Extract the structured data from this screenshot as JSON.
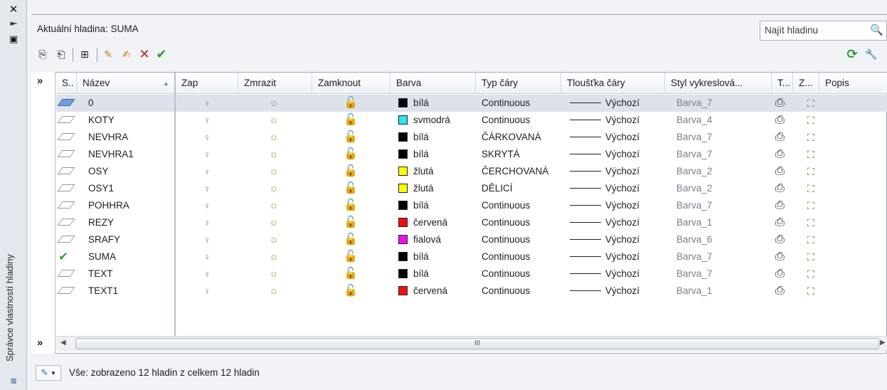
{
  "sidebar_title": "Správce vlastností hladiny",
  "current_layer": "Aktuální hladina: SUMA",
  "search": {
    "placeholder": "Najít hladinu"
  },
  "icons": {
    "close": "✕",
    "autohide": "⇤",
    "properties": "▣",
    "filter_new": "⎘",
    "filter_group": "⎗",
    "states": "⊞",
    "new_layer": "✎",
    "new_layer_vp": "✍",
    "delete": "✕",
    "set_current": "✔",
    "refresh": "⟳",
    "settings": "🔧",
    "search": "🔍",
    "bulb": "♀",
    "sun": "☼",
    "lock": "🔓",
    "printer": "⎙",
    "vp_freeze": "⛶",
    "chevron": "»",
    "scroll_grip": "III",
    "scroll_left": "◀",
    "scroll_right": "▶",
    "status_filter": "▼"
  },
  "columns": [
    "S..",
    "Název",
    "Zap",
    "Zmrazit",
    "Zamknout",
    "Barva",
    "Typ čáry",
    "Tloušťka čáry",
    "Styl vykreslová...",
    "T...",
    "Z...",
    "Popis"
  ],
  "rows": [
    {
      "status": "layer",
      "name": "0",
      "color": "bílá",
      "hex": "#000000",
      "linetype": "Continuous",
      "lineweight": "Výchozí",
      "plotstyle": "Barva_7",
      "selected": true
    },
    {
      "status": "layer",
      "name": "KOTY",
      "color": "svmodrá",
      "hex": "#27e6f2",
      "linetype": "Continuous",
      "lineweight": "Výchozí",
      "plotstyle": "Barva_4"
    },
    {
      "status": "layer",
      "name": "NEVHRA",
      "color": "bílá",
      "hex": "#000000",
      "linetype": "ČÁRKOVANÁ",
      "lineweight": "Výchozí",
      "plotstyle": "Barva_7"
    },
    {
      "status": "layer",
      "name": "NEVHRA1",
      "color": "bílá",
      "hex": "#000000",
      "linetype": "SKRYTÁ",
      "lineweight": "Výchozí",
      "plotstyle": "Barva_7"
    },
    {
      "status": "layer",
      "name": "OSY",
      "color": "žlutá",
      "hex": "#ffff00",
      "linetype": "ČERCHOVANÁ",
      "lineweight": "Výchozí",
      "plotstyle": "Barva_2"
    },
    {
      "status": "layer",
      "name": "OSY1",
      "color": "žlutá",
      "hex": "#ffff00",
      "linetype": "DĚLICÍ",
      "lineweight": "Výchozí",
      "plotstyle": "Barva_2"
    },
    {
      "status": "layer",
      "name": "POHHRA",
      "color": "bílá",
      "hex": "#000000",
      "linetype": "Continuous",
      "lineweight": "Výchozí",
      "plotstyle": "Barva_7"
    },
    {
      "status": "layer",
      "name": "REZY",
      "color": "červená",
      "hex": "#ee1111",
      "linetype": "Continuous",
      "lineweight": "Výchozí",
      "plotstyle": "Barva_1"
    },
    {
      "status": "layer",
      "name": "SRAFY",
      "color": "fialová",
      "hex": "#ee11ee",
      "linetype": "Continuous",
      "lineweight": "Výchozí",
      "plotstyle": "Barva_6"
    },
    {
      "status": "current",
      "name": "SUMA",
      "color": "bílá",
      "hex": "#000000",
      "linetype": "Continuous",
      "lineweight": "Výchozí",
      "plotstyle": "Barva_7"
    },
    {
      "status": "layer",
      "name": "TEXT",
      "color": "bílá",
      "hex": "#000000",
      "linetype": "Continuous",
      "lineweight": "Výchozí",
      "plotstyle": "Barva_7"
    },
    {
      "status": "layer",
      "name": "TEXT1",
      "color": "červená",
      "hex": "#ee1111",
      "linetype": "Continuous",
      "lineweight": "Výchozí",
      "plotstyle": "Barva_1"
    }
  ],
  "status_text": "Vše: zobrazeno 12 hladin z celkem 12 hladin"
}
